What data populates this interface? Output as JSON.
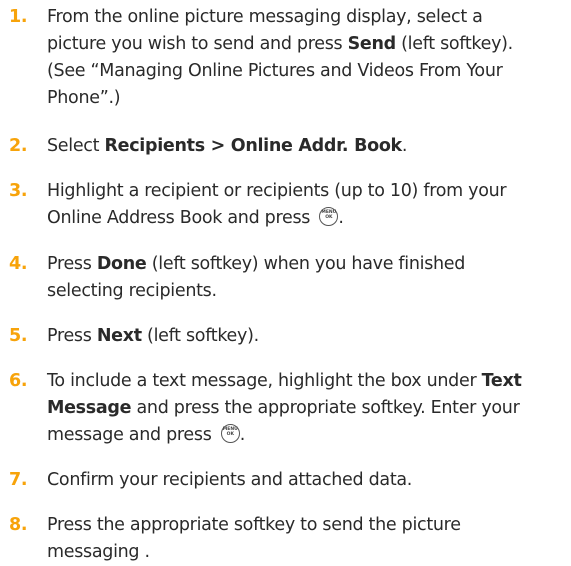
{
  "steps": [
    {
      "number": "1.",
      "lines": [
        [
          {
            "t": "From the online picture messaging  display, select a",
            "b": false
          }
        ],
        [
          {
            "t": "picture you wish to send and press ",
            "b": false
          },
          {
            "t": "Send",
            "b": true
          },
          {
            "t": " (left softkey).",
            "b": false
          }
        ],
        [
          {
            "t": "(See “Managing Online Pictures and Videos From Your",
            "b": false
          }
        ],
        [
          {
            "t": "Phone”.)",
            "b": false
          }
        ]
      ]
    },
    {
      "number": "2.",
      "lines": [
        [
          {
            "t": "Select ",
            "b": false
          },
          {
            "t": "Recipients > Online Addr. Book",
            "b": true
          },
          {
            "t": ".",
            "b": false
          }
        ]
      ]
    },
    {
      "number": "3.",
      "lines": [
        [
          {
            "t": "Highlight a recipient or recipients (up to 10) from your",
            "b": false
          }
        ],
        [
          {
            "t": "Online Address Book and press ",
            "b": false
          },
          {
            "icon": "menu-ok-key-icon"
          },
          {
            "t": ".",
            "b": false
          }
        ]
      ]
    },
    {
      "number": "4.",
      "lines": [
        [
          {
            "t": "Press ",
            "b": false
          },
          {
            "t": "Done",
            "b": true
          },
          {
            "t": " (left softkey) when you have finished",
            "b": false
          }
        ],
        [
          {
            "t": "selecting recipients.",
            "b": false
          }
        ]
      ]
    },
    {
      "number": "5.",
      "lines": [
        [
          {
            "t": "Press ",
            "b": false
          },
          {
            "t": "Next",
            "b": true
          },
          {
            "t": " (left softkey).",
            "b": false
          }
        ]
      ]
    },
    {
      "number": "6.",
      "lines": [
        [
          {
            "t": "To include a text message, highlight the box under ",
            "b": false
          },
          {
            "t": "Text",
            "b": true
          }
        ],
        [
          {
            "t": "Message",
            "b": true
          },
          {
            "t": " and press the appropriate softkey. Enter your",
            "b": false
          }
        ],
        [
          {
            "t": "message and press ",
            "b": false
          },
          {
            "icon": "menu-ok-key-icon"
          },
          {
            "t": ".",
            "b": false
          }
        ]
      ]
    },
    {
      "number": "7.",
      "lines": [
        [
          {
            "t": "Confirm your recipients and attached data.",
            "b": false
          }
        ]
      ]
    },
    {
      "number": "8.",
      "lines": [
        [
          {
            "t": "Press the appropriate softkey to send the picture",
            "b": false
          }
        ],
        [
          {
            "t": "messaging .",
            "b": false
          }
        ]
      ]
    }
  ],
  "key_icon": {
    "line1": "MENU",
    "line2": "OK"
  },
  "colors": {
    "step_number": "#f7a30a",
    "text": "#2a2a2a"
  }
}
